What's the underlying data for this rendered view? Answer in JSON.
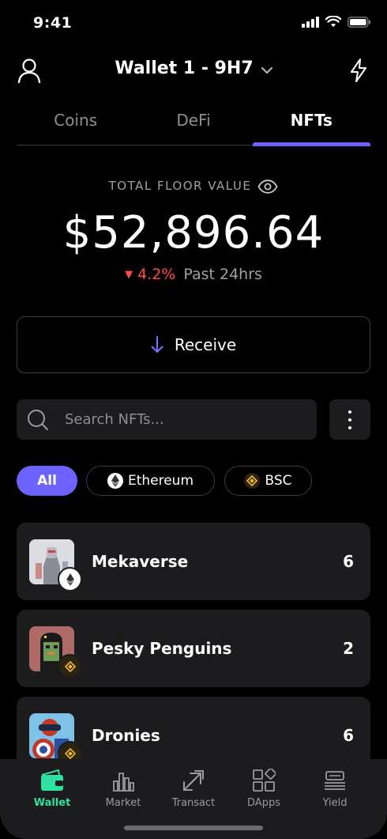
{
  "status_bar": {
    "time": "9:41"
  },
  "header": {
    "wallet_name": "Wallet 1 - 9H7"
  },
  "tabs": [
    {
      "label": "Coins",
      "active": false
    },
    {
      "label": "DeFi",
      "active": false
    },
    {
      "label": "NFTs",
      "active": true
    }
  ],
  "summary": {
    "label": "TOTAL FLOOR VALUE",
    "value": "$52,896.64",
    "change_pct": "4.2%",
    "change_direction": "down",
    "period": "Past 24hrs"
  },
  "receive_button": {
    "label": "Receive"
  },
  "search": {
    "placeholder": "Search NFTs..."
  },
  "filters": [
    {
      "label": "All",
      "active": true
    },
    {
      "label": "Ethereum",
      "icon": "ethereum-icon"
    },
    {
      "label": "BSC",
      "icon": "bnb-icon"
    }
  ],
  "collections": [
    {
      "name": "Mekaverse",
      "count": "6",
      "chain": "ethereum"
    },
    {
      "name": "Pesky Penguins",
      "count": "2",
      "chain": "bsc"
    },
    {
      "name": "Dronies",
      "count": "6",
      "chain": "bsc"
    }
  ],
  "bottom_nav": [
    {
      "label": "Wallet",
      "icon": "wallet-icon",
      "active": true
    },
    {
      "label": "Market",
      "icon": "chart-icon"
    },
    {
      "label": "Transact",
      "icon": "transact-icon"
    },
    {
      "label": "DApps",
      "icon": "apps-icon"
    },
    {
      "label": "Yield",
      "icon": "yield-icon"
    }
  ],
  "colors": {
    "accent": "#6c63ff",
    "negative": "#ff4a4a",
    "nav_active": "#2fe0a0",
    "card_bg": "#1c1c1e"
  }
}
